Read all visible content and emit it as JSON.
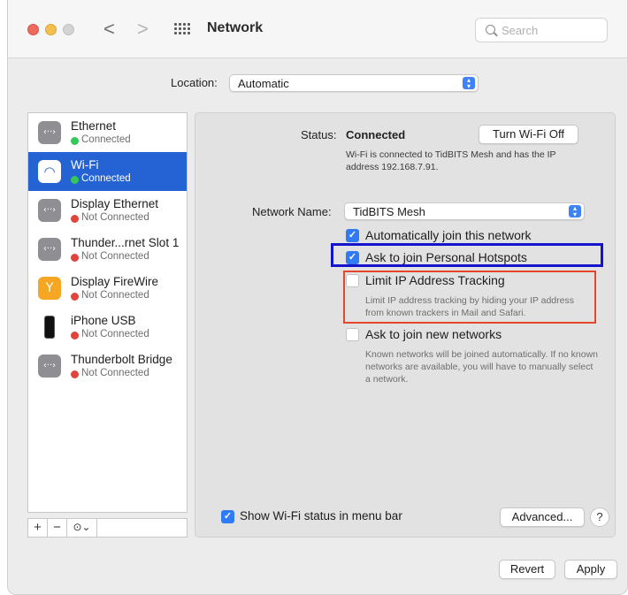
{
  "window": {
    "title": "Network",
    "back_glyph": "<",
    "forward_glyph": ">",
    "search_placeholder": "Search"
  },
  "location": {
    "label": "Location:",
    "value": "Automatic"
  },
  "services": [
    {
      "name": "Ethernet",
      "status": "Connected",
      "status_color": "#34c759",
      "icon": "ethernet-icon",
      "selected": false
    },
    {
      "name": "Wi-Fi",
      "status": "Connected",
      "status_color": "#34c759",
      "icon": "wifi-icon",
      "selected": true
    },
    {
      "name": "Display Ethernet",
      "status": "Not Connected",
      "status_color": "#e0443a",
      "icon": "ethernet-icon",
      "selected": false
    },
    {
      "name": "Thunder...rnet Slot 1",
      "status": "Not Connected",
      "status_color": "#e0443a",
      "icon": "ethernet-icon",
      "selected": false
    },
    {
      "name": "Display FireWire",
      "status": "Not Connected",
      "status_color": "#e0443a",
      "icon": "firewire-icon",
      "selected": false
    },
    {
      "name": "iPhone USB",
      "status": "Not Connected",
      "status_color": "#e0443a",
      "icon": "iphone-icon",
      "selected": false
    },
    {
      "name": "Thunderbolt Bridge",
      "status": "Not Connected",
      "status_color": "#e0443a",
      "icon": "ethernet-icon",
      "selected": false
    }
  ],
  "sidebar_controls": {
    "add": "+",
    "remove": "−",
    "action": "⊙⌄"
  },
  "detail": {
    "status_label": "Status:",
    "status_value": "Connected",
    "toggle_button": "Turn Wi-Fi Off",
    "status_description": "Wi-Fi is connected to TidBITS Mesh and has the IP address 192.168.7.91.",
    "network_name_label": "Network Name:",
    "network_name_value": "TidBITS Mesh",
    "options": [
      {
        "label": "Automatically join this network",
        "checked": true
      },
      {
        "label": "Ask to join Personal Hotspots",
        "checked": true
      },
      {
        "label": "Limit IP Address Tracking",
        "checked": false,
        "description": "Limit IP address tracking by hiding your IP address from known trackers in Mail and Safari."
      },
      {
        "label": "Ask to join new networks",
        "checked": false,
        "description": "Known networks will be joined automatically. If no known networks are available, you will have to manually select a network."
      }
    ],
    "show_status_label": "Show Wi-Fi status in menu bar",
    "show_status_checked": true,
    "advanced_button": "Advanced...",
    "help_button": "?"
  },
  "footer": {
    "revert_button": "Revert",
    "apply_button": "Apply"
  },
  "annotation_colors": {
    "blue_box": "#1414cc",
    "red_box": "#e4462e"
  }
}
